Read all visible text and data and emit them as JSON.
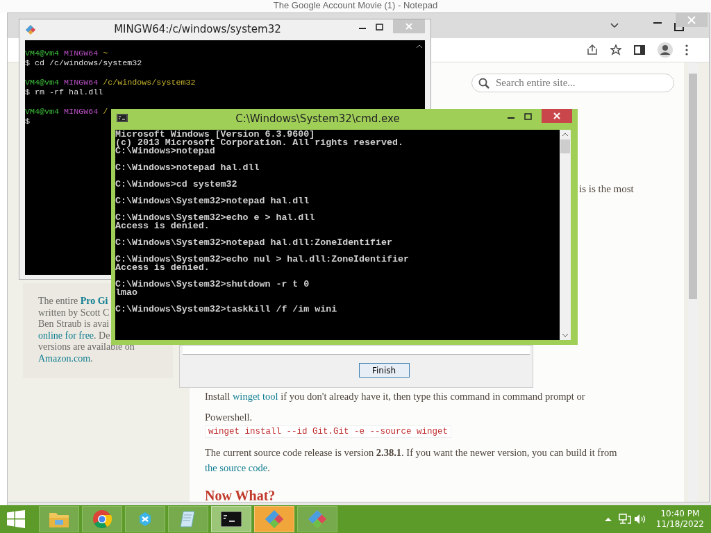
{
  "background_window": {
    "title": "The Google Account Movie (1) - Notepad"
  },
  "browser": {
    "search": {
      "placeholder": "Search entire site..."
    },
    "sidebar_card": {
      "lines": [
        [
          {
            "kind": "text",
            "text": "The entire "
          },
          {
            "kind": "strong-link",
            "text": "Pro Gi"
          }
        ],
        [
          {
            "kind": "text",
            "text": "written by Scott C"
          }
        ],
        [
          {
            "kind": "text",
            "text": "Ben Straub is avai"
          }
        ],
        [
          {
            "kind": "link",
            "text": "online for free"
          },
          {
            "kind": "text",
            "text": ". De"
          }
        ],
        [
          {
            "kind": "text",
            "text": "versions are available on"
          }
        ],
        [
          {
            "kind": "link",
            "text": "Amazon.com"
          },
          {
            "kind": "text",
            "text": "."
          }
        ]
      ]
    },
    "fragment": "is is the most",
    "install_text": [
      {
        "kind": "text",
        "text": "Install "
      },
      {
        "kind": "link",
        "text": "winget tool"
      },
      {
        "kind": "text",
        "text": " if you don't already have it, then type this command in command prompt or"
      }
    ],
    "powershell": "Powershell.",
    "command": "winget install --id Git.Git -e --source winget",
    "release_text": [
      {
        "kind": "text",
        "text": "The current source code release is version **2.38.1**. If you want the newer version, you can build it from"
      },
      {
        "kind": "link",
        "text": "the source code"
      },
      {
        "kind": "text",
        "text": "."
      }
    ],
    "heading": "Now What?"
  },
  "installer": {
    "button": "Finish"
  },
  "git_bash": {
    "title": "MINGW64:/c/windows/system32",
    "blocks": [
      [
        [
          {
            "kind": "user",
            "text": "VM4@vm4"
          },
          {
            "kind": "host",
            "text": "MINGW64"
          },
          {
            "kind": "path",
            "text": "~"
          }
        ],
        [
          {
            "kind": "plain",
            "text": "$ cd /c/windows/system32"
          }
        ]
      ],
      [
        [
          {
            "kind": "user",
            "text": "VM4@vm4"
          },
          {
            "kind": "host",
            "text": "MINGW64"
          },
          {
            "kind": "path",
            "text": "/c/windows/system32"
          }
        ],
        [
          {
            "kind": "plain",
            "text": "$ rm -rf hal.dll"
          }
        ]
      ],
      [
        [
          {
            "kind": "user",
            "text": "VM4@vm4"
          },
          {
            "kind": "host",
            "text": "MINGW64"
          },
          {
            "kind": "path",
            "text": "/"
          }
        ],
        [
          {
            "kind": "plain",
            "text": "$"
          }
        ]
      ]
    ]
  },
  "cmd": {
    "title": "C:\\Windows\\System32\\cmd.exe",
    "blocks": [
      [
        "Microsoft Windows [Version 6.3.9600]",
        "(c) 2013 Microsoft Corporation. All rights reserved.",
        "C:\\Windows>notepad"
      ],
      [
        "C:\\Windows>notepad hal.dll"
      ],
      [
        "C:\\Windows>cd system32"
      ],
      [
        "C:\\Windows\\System32>notepad hal.dll"
      ],
      [
        "C:\\Windows\\System32>echo e > hal.dll",
        "Access is denied."
      ],
      [
        "C:\\Windows\\System32>notepad hal.dll:ZoneIdentifier"
      ],
      [
        "C:\\Windows\\System32>echo nul > hal.dll:ZoneIdentifier",
        "Access is denied."
      ],
      [
        "C:\\Windows\\System32>shutdown -r t 0",
        "lmao"
      ],
      [
        "C:\\Windows\\System32>taskkill /f /im wini"
      ]
    ]
  },
  "taskbar": {
    "apps": [
      {
        "kind": "folder",
        "selected": false,
        "hovered": false
      },
      {
        "kind": "browser",
        "selected": false,
        "hovered": false
      },
      {
        "kind": "blob",
        "selected": false,
        "hovered": false
      },
      {
        "kind": "notepad",
        "selected": false,
        "hovered": false
      },
      {
        "kind": "console",
        "selected": false,
        "hovered": true
      },
      {
        "kind": "git",
        "selected": true,
        "hovered": false
      },
      {
        "kind": "git",
        "selected": false,
        "hovered": false
      }
    ],
    "time": "10:40 PM",
    "date": "11/18/2022"
  }
}
